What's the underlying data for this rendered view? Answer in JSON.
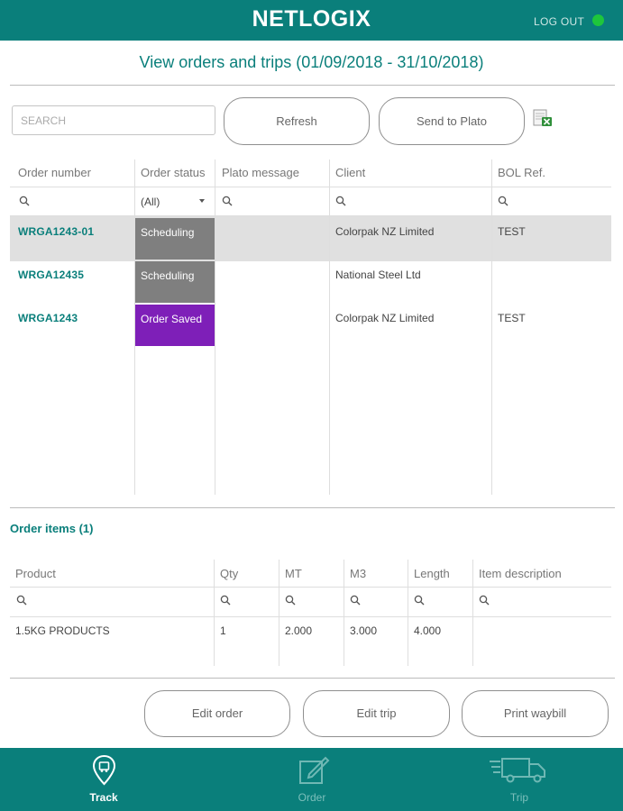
{
  "header": {
    "brand": "NETLOGIX",
    "logout_label": "LOG OUT",
    "status_color": "#1ec63c",
    "accent_color": "#0a7f7b"
  },
  "page": {
    "title": "View orders and trips (01/09/2018 - 31/10/2018)"
  },
  "toolbar": {
    "search_placeholder": "SEARCH",
    "refresh_label": "Refresh",
    "send_label": "Send to Plato",
    "export_icon": "excel-export-icon"
  },
  "orders": {
    "columns": [
      "Order number",
      "Order status",
      "Plato message",
      "Client",
      "BOL Ref."
    ],
    "status_filter": "(All)",
    "rows": [
      {
        "order_number": "WRGA1243-01",
        "status": "Scheduling",
        "status_color": "#7f7f7f",
        "plato_message": "",
        "client": "Colorpak NZ Limited",
        "bol_ref": "TEST"
      },
      {
        "order_number": "WRGA12435",
        "status": "Scheduling",
        "status_color": "#7f7f7f",
        "plato_message": "",
        "client": "National Steel Ltd",
        "bol_ref": ""
      },
      {
        "order_number": "WRGA1243",
        "status": "Order Saved",
        "status_color": "#7e1fb8",
        "plato_message": "",
        "client": "Colorpak NZ Limited",
        "bol_ref": "TEST"
      }
    ]
  },
  "items": {
    "title": "Order items (1)",
    "columns": [
      "Product",
      "Qty",
      "MT",
      "M3",
      "Length",
      "Item description"
    ],
    "rows": [
      {
        "product": "1.5KG PRODUCTS",
        "qty": "1",
        "mt": "2.000",
        "m3": "3.000",
        "length": "4.000",
        "description": ""
      }
    ]
  },
  "actions": {
    "edit_order": "Edit order",
    "edit_trip": "Edit trip",
    "print_waybill": "Print waybill"
  },
  "nav": {
    "items": [
      {
        "label": "Track",
        "icon": "location-pin-icon",
        "active": true
      },
      {
        "label": "Order",
        "icon": "edit-icon",
        "active": false
      },
      {
        "label": "Trip",
        "icon": "truck-icon",
        "active": false
      }
    ]
  }
}
